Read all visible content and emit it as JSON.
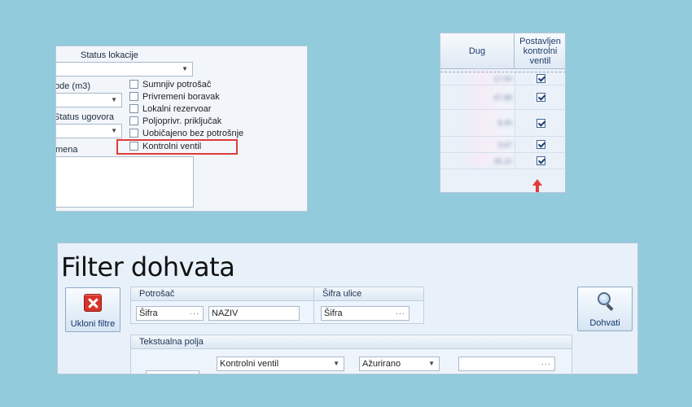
{
  "form": {
    "status_lokacije_label": "Status lokacije",
    "vode_label": "ode (m3)",
    "status_ugovora_label": "Status ugovora",
    "napomena_label": "mena",
    "checkboxes": [
      {
        "label": "Sumnjiv potrošač",
        "checked": false
      },
      {
        "label": "Privremeni boravak",
        "checked": false
      },
      {
        "label": "Lokalni rezervoar",
        "checked": false
      },
      {
        "label": "Poljoprivr. priključak",
        "checked": false
      },
      {
        "label": "Uobičajeno bez potrošnje",
        "checked": false
      },
      {
        "label": "Kontrolni ventil",
        "checked": false
      }
    ],
    "highlight_color": "#e03b3b"
  },
  "grid": {
    "col_dug": "Dug",
    "col_kontrolni": "Postavljen kontrolni ventil",
    "rows": [
      {
        "dug": "17,00",
        "checked": true
      },
      {
        "dug": "47,88",
        "checked": true
      },
      {
        "dug": "8,45",
        "checked": true
      },
      {
        "dug": "3,67",
        "checked": true
      },
      {
        "dug": "35,10",
        "checked": true
      }
    ]
  },
  "filter": {
    "title": "Filter dohvata",
    "ukloni_label": "Ukloni filtre",
    "dohvati_label": "Dohvati",
    "potrosac_group": "Potrošač",
    "potrosac_sifra_placeholder": "Šifra",
    "potrosac_naziv_placeholder": "NAZIV",
    "ulice_group": "Šifra ulice",
    "ulice_sifra_placeholder": "Šifra",
    "tekst_group": "Tekstualna polja",
    "field_select": "Kontrolni ventil",
    "operator_select": "Ažurirano",
    "value_input": ""
  }
}
